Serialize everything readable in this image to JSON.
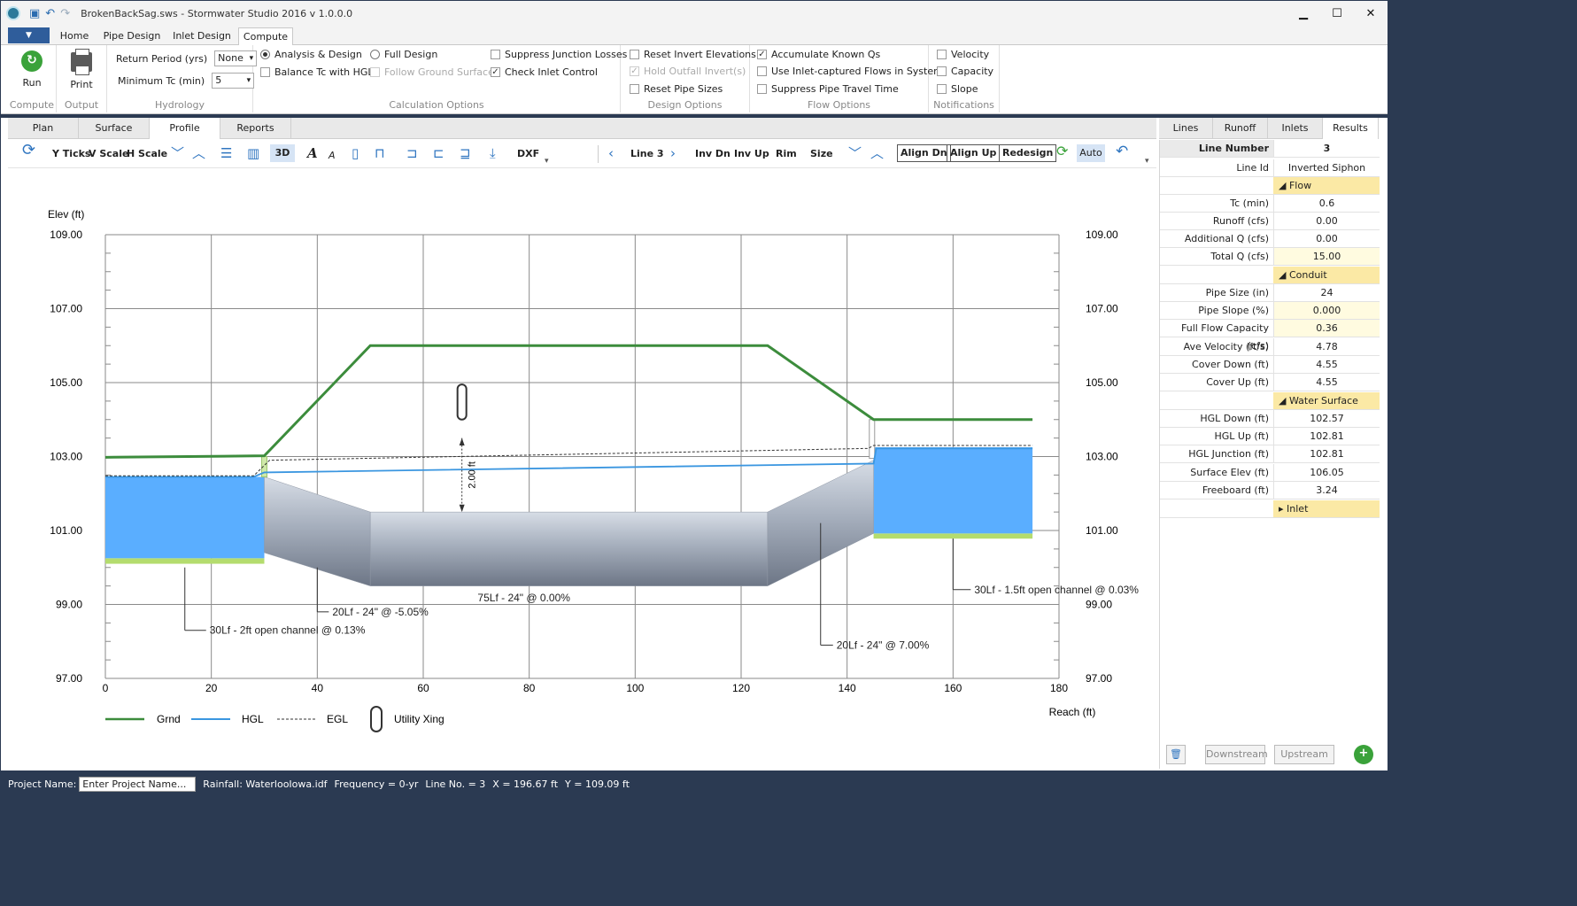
{
  "window": {
    "title": "BrokenBackSag.sws - Stormwater Studio 2016 v 1.0.0.0",
    "min": "▁",
    "max": "☐",
    "close": "✕"
  },
  "ribbon_tabs": [
    "Home",
    "Pipe Design",
    "Inlet Design",
    "Compute"
  ],
  "ribbon": {
    "run": "Run",
    "print": "Print",
    "groups": {
      "compute": "Compute",
      "output": "Output",
      "hydrology": "Hydrology",
      "calc": "Calculation Options",
      "design": "Design Options",
      "flow": "Flow Options",
      "notif": "Notifications"
    },
    "return_period_label": "Return Period (yrs)",
    "return_period_value": "None",
    "min_tc_label": "Minimum Tc (min)",
    "min_tc_value": "5",
    "analysis_design": "Analysis & Design",
    "full_design": "Full Design",
    "balance_tc": "Balance Tc with HGL",
    "follow_ground": "Follow Ground Surface",
    "suppress_junction": "Suppress Junction Losses",
    "check_inlet": "Check Inlet Control",
    "reset_invert": "Reset Invert Elevations",
    "hold_outfall": "Hold Outfall Invert(s)",
    "reset_pipe": "Reset Pipe Sizes",
    "accumulate": "Accumulate Known Qs",
    "use_inlet": "Use Inlet-captured Flows in System",
    "suppress_travel": "Suppress Pipe Travel Time",
    "velocity": "Velocity",
    "capacity": "Capacity",
    "slope": "Slope"
  },
  "view_tabs": [
    "Plan",
    "Surface",
    "Profile",
    "Reports"
  ],
  "toolbar": {
    "yticks": "Y Ticks",
    "vscale": "V Scale",
    "hscale": "H Scale",
    "three_d": "3D",
    "dxf": "DXF",
    "line": "Line 3",
    "inv_dn": "Inv Dn",
    "inv_up": "Inv Up",
    "rim": "Rim",
    "size": "Size",
    "align_dn": "Align Dn",
    "align_up": "Align Up",
    "redesign": "Redesign",
    "auto": "Auto"
  },
  "chart_data": {
    "type": "line",
    "ylabel": "Elev (ft)",
    "xlabel": "Reach (ft)",
    "xlim": [
      0,
      180
    ],
    "ylim": [
      97,
      109
    ],
    "xticks": [
      "0",
      "20",
      "40",
      "60",
      "80",
      "100",
      "120",
      "140",
      "160",
      "180"
    ],
    "yticks": [
      "97.00",
      "99.00",
      "101.00",
      "103.00",
      "105.00",
      "107.00",
      "109.00"
    ],
    "series": [
      {
        "name": "Grnd",
        "color": "#3c8c3c",
        "x": [
          0,
          30,
          50,
          125,
          145,
          175
        ],
        "y": [
          102.98,
          103.02,
          106.0,
          106.0,
          104.0,
          104.0
        ]
      },
      {
        "name": "HGL",
        "color": "#3a96e0",
        "x": [
          0,
          28,
          30,
          145,
          145.5,
          175
        ],
        "y": [
          102.45,
          102.45,
          102.57,
          102.81,
          103.22,
          103.22
        ]
      },
      {
        "name": "EGL",
        "color": "#333333",
        "x": [
          0,
          28,
          31,
          144,
          145,
          175
        ],
        "y": [
          102.48,
          102.48,
          102.9,
          103.22,
          103.3,
          103.3
        ]
      }
    ],
    "legend": [
      "Grnd",
      "HGL",
      "EGL",
      "Utility Xing"
    ],
    "dimension_label": "2.00 ft",
    "annotations": [
      "30Lf - 2ft open channel @ 0.13%",
      "20Lf - 24\" @ -5.05%",
      "75Lf - 24\" @ 0.00%",
      "20Lf - 24\" @ 7.00%",
      "30Lf - 1.5ft open channel @ 0.03%"
    ]
  },
  "results_tabs": [
    "Lines",
    "Runoff",
    "Inlets",
    "Results"
  ],
  "results": {
    "line_number_label": "Line Number",
    "line_number": "3",
    "line_id_label": "Line Id",
    "line_id": "Inverted Siphon",
    "flow": "Flow",
    "conduit": "Conduit",
    "water_surface": "Water Surface",
    "inlet": "Inlet",
    "rows": [
      {
        "label": "Tc (min)",
        "value": "0.6"
      },
      {
        "label": "Runoff (cfs)",
        "value": "0.00"
      },
      {
        "label": "Additional Q (cfs)",
        "value": "0.00"
      },
      {
        "label": "Total Q (cfs)",
        "value": "15.00"
      },
      {
        "label": "Pipe Size (in)",
        "value": "24"
      },
      {
        "label": "Pipe Slope (%)",
        "value": "0.000"
      },
      {
        "label": "Full Flow Capacity (cfs)",
        "value": "0.36"
      },
      {
        "label": "Ave Velocity (ft/s)",
        "value": "4.78"
      },
      {
        "label": "Cover Down (ft)",
        "value": "4.55"
      },
      {
        "label": "Cover Up (ft)",
        "value": "4.55"
      },
      {
        "label": "HGL Down (ft)",
        "value": "102.57"
      },
      {
        "label": "HGL Up (ft)",
        "value": "102.81"
      },
      {
        "label": "HGL Junction (ft)",
        "value": "102.81"
      },
      {
        "label": "Surface Elev (ft)",
        "value": "106.05"
      },
      {
        "label": "Freeboard (ft)",
        "value": "3.24"
      }
    ],
    "downstream": "Downstream",
    "upstream": "Upstream"
  },
  "status": {
    "project_label": "Project Name:",
    "project_placeholder": "Enter Project Name...",
    "rainfall": "Rainfall: WaterlooIowa.idf",
    "frequency": "Frequency = 0-yr",
    "line_no": "Line No. = 3",
    "x": "X = 196.67 ft",
    "y": "Y = 109.09 ft"
  }
}
